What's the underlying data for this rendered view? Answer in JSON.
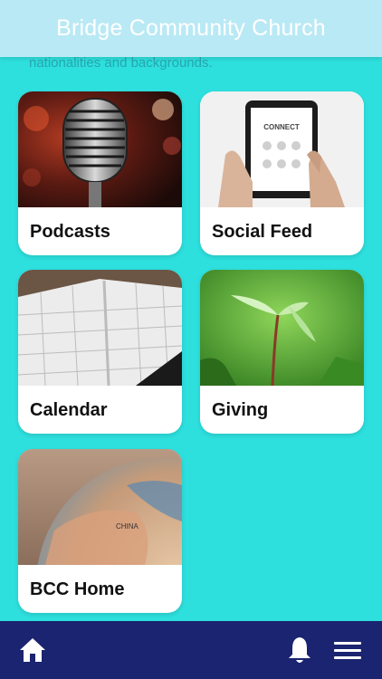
{
  "header": {
    "title": "Bridge Community Church"
  },
  "intro": {
    "text": "nationalities and backgrounds."
  },
  "tiles": [
    {
      "label": "Podcasts",
      "icon": "microphone-image"
    },
    {
      "label": "Social Feed",
      "icon": "tablet-connect-image",
      "image_text": "CONNECT"
    },
    {
      "label": "Calendar",
      "icon": "calendar-image"
    },
    {
      "label": "Giving",
      "icon": "seedling-image"
    },
    {
      "label": "BCC Home",
      "icon": "globe-image",
      "image_text": "CHINA"
    }
  ],
  "bottom_nav": {
    "home": "home-icon",
    "notifications": "bell-icon",
    "menu": "hamburger-menu-icon"
  },
  "colors": {
    "background": "#2ddfdd",
    "header": "#b9e9f4",
    "bottom_bar": "#1b2470",
    "card": "#ffffff"
  }
}
